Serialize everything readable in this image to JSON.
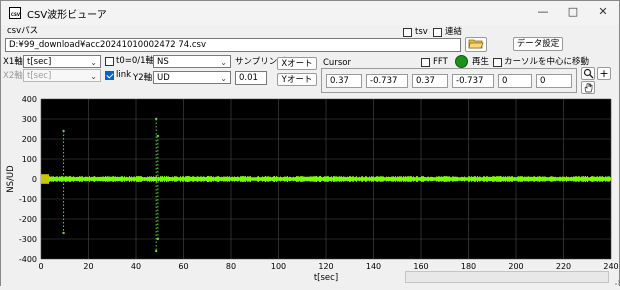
{
  "window": {
    "title": "CSV波形ビューア",
    "icon_text": "CSV",
    "icons": {
      "minimize": "minimize-icon",
      "maximize": "maximize-icon",
      "close": "close-icon"
    }
  },
  "file": {
    "path_label": "csvパス",
    "path": "D:¥99_download¥acc20241010002472 74.csv",
    "browse_icon": "folder-open-icon"
  },
  "options": {
    "tsv_label": "tsv",
    "tsv_checked": false,
    "concat_label": "連結",
    "concat_checked": false,
    "data_settings_label": "データ設定"
  },
  "axes_controls": {
    "x1_label": "X1軸",
    "x1_value": "t[sec]",
    "x2_label": "X2軸",
    "x2_value": "t[sec]",
    "t0_label": "t0=0/1軸",
    "t0_checked": false,
    "link_label": "link",
    "link_checked": true,
    "y1_value": "NS",
    "y2_label": "Y2軸",
    "y2_value": "UD",
    "sampling_label": "サンプリング",
    "sampling_value": "0.01",
    "x_auto_label": "Xオート",
    "y_auto_label": "Yオート"
  },
  "cursor": {
    "label": "Cursor",
    "fft_label": "FFT",
    "fft_checked": false,
    "play_label": "再生",
    "center_label": "カーソルを中心に移動",
    "center_checked": false,
    "values": [
      "0.37",
      "-0.737",
      "0.37",
      "-0.737",
      "0",
      "0"
    ],
    "zoom_icon": "zoom-icon",
    "pan_icon": "hand-pan-icon"
  },
  "accent": {
    "signal": "#7cfc00",
    "play": "#1f8f1f",
    "spike": "#5ed43a"
  },
  "chart_data": {
    "type": "line",
    "title": "",
    "xlabel": "t[sec]",
    "ylabel": "NS/UD",
    "xlim": [
      0,
      240
    ],
    "ylim": [
      -400,
      400
    ],
    "x_ticks": [
      0,
      20,
      40,
      60,
      80,
      100,
      120,
      140,
      160,
      180,
      200,
      220,
      240
    ],
    "y_ticks": [
      400,
      300,
      200,
      100,
      0,
      -100,
      -200,
      -300,
      -400
    ],
    "grid": true,
    "series": [
      {
        "color": "#7cfc00",
        "baseline": 0,
        "noise_amplitude": 15,
        "x": [
          9.5,
          48.5,
          49.2
        ],
        "max": [
          240,
          300,
          215
        ],
        "min": [
          -270,
          -360,
          -300
        ]
      }
    ]
  }
}
